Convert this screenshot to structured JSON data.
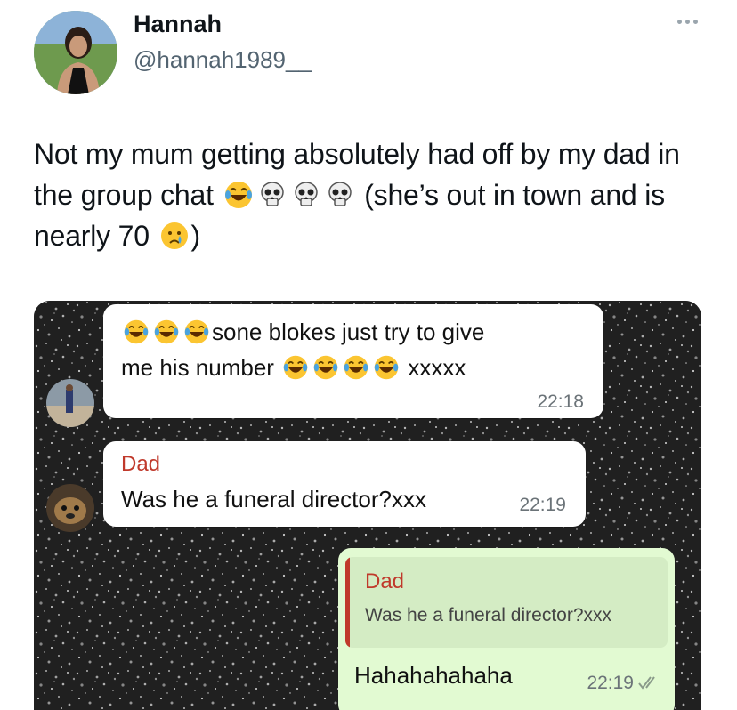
{
  "tweet": {
    "author_name": "Hannah",
    "author_handle": "@hannah1989__",
    "text_part1": "Not my mum getting absolutely had off by my dad in the group chat ",
    "text_part2": " (she’s out in town and is nearly 70 ",
    "text_part3": ")",
    "more_icon": "more-options-icon"
  },
  "chat": {
    "messages": [
      {
        "text_line1": "sone blokes just try to give",
        "text_line2_a": "me his number ",
        "text_line2_b": " xxxxx",
        "time": "22:18"
      },
      {
        "sender": "Dad",
        "text": "Was he a funeral director?xxx",
        "time": "22:19"
      },
      {
        "quoted_sender": "Dad",
        "quoted_text": "Was he a funeral director?xxx",
        "text": "Hahahahahaha",
        "time": "22:19",
        "status_icon": "double-check-icon"
      }
    ],
    "colors": {
      "sender_name": "#c0392b",
      "outgoing_bubble": "#e2fad2",
      "quote_background": "#d4ecc4"
    }
  }
}
